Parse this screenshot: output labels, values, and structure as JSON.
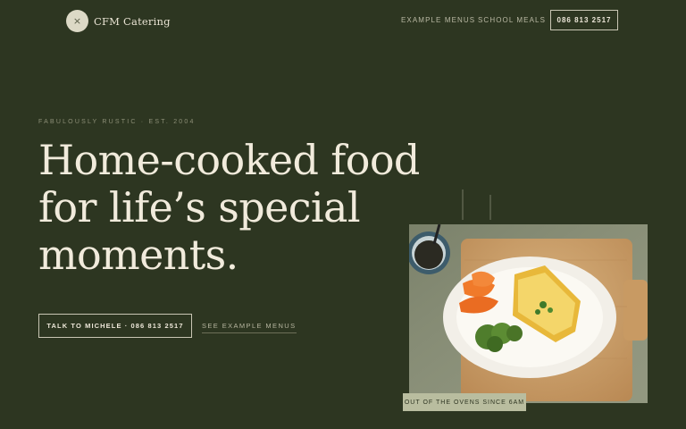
{
  "header": {
    "logo_mark": "×",
    "brand": "CFM Catering",
    "nav": [
      {
        "label": "EXAMPLE MENUS"
      },
      {
        "label": "SCHOOL MEALS"
      }
    ],
    "phone_button": "086 813 2517"
  },
  "hero": {
    "eyebrow": "FABULOUSLY RUSTIC · EST. 2004",
    "headline_lines": [
      "Home-cooked food",
      "for life’s special",
      "moments."
    ],
    "cta_primary": "TALK TO MICHELE · 086 813 2517",
    "cta_secondary": "SEE EXAMPLE MENUS"
  },
  "photo": {
    "badge": "OUT OF THE OVENS SINCE 6AM"
  }
}
